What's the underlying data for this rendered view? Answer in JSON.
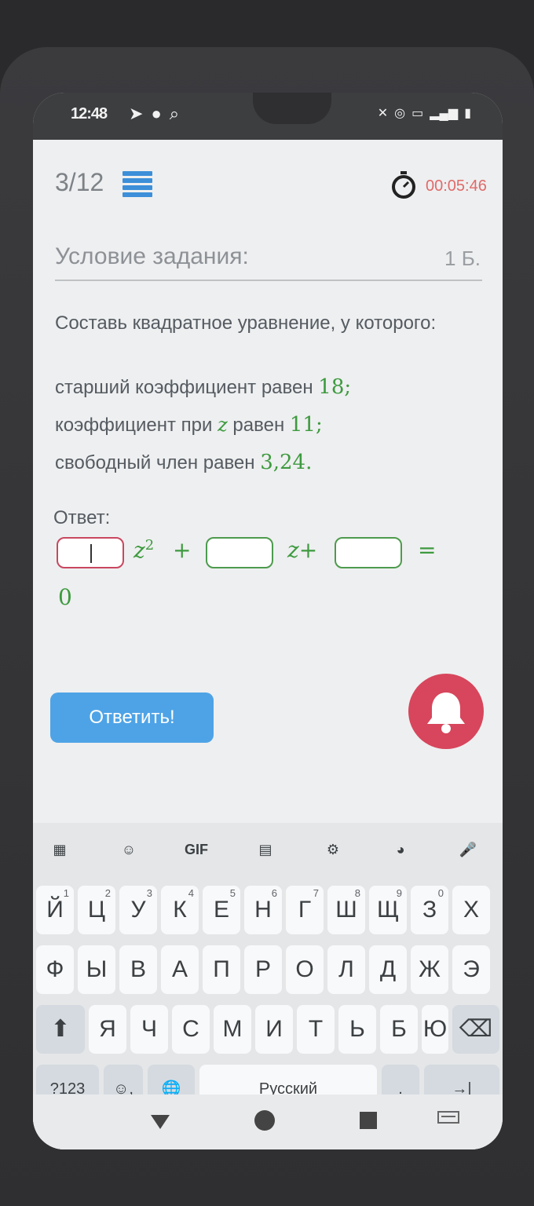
{
  "status_bar": {
    "time": "12:48",
    "left_icons": [
      "telegram-icon",
      "circle-icon",
      "search-icon"
    ],
    "right_icons": [
      "mute-icon",
      "hotspot-icon",
      "network-icon",
      "signal-icon",
      "battery-icon"
    ]
  },
  "header": {
    "counter": "3/12",
    "timer": "00:05:46"
  },
  "task": {
    "section_title": "Условие задания:",
    "score": "1 Б.",
    "prompt": "Составь квадратное уравнение, у которого:",
    "conditions": [
      {
        "text": "старший коэффициент равен ",
        "value": "18",
        "suffix": ";"
      },
      {
        "text": "коэффициент при ",
        "var": "z",
        "text2": " равен ",
        "value": "11",
        "suffix": ";"
      },
      {
        "text": "свободный член равен ",
        "value": "3,24",
        "suffix": "."
      }
    ]
  },
  "answer": {
    "label": "Ответ:",
    "term1": "z",
    "exp": "2",
    "plus": "+",
    "term2": "z+",
    "equals": "=",
    "rhs": "0"
  },
  "buttons": {
    "submit": "Ответить!"
  },
  "keyboard": {
    "toolbar": [
      "apps-icon",
      "sticker-icon",
      "GIF",
      "clipboard-icon",
      "gear-icon",
      "palette-icon",
      "mic-icon"
    ],
    "row1": [
      [
        "Й",
        "1"
      ],
      [
        "Ц",
        "2"
      ],
      [
        "У",
        "3"
      ],
      [
        "К",
        "4"
      ],
      [
        "Е",
        "5"
      ],
      [
        "Н",
        "6"
      ],
      [
        "Г",
        "7"
      ],
      [
        "Ш",
        "8"
      ],
      [
        "Щ",
        "9"
      ],
      [
        "З",
        "0"
      ],
      [
        "Х",
        ""
      ]
    ],
    "row2": [
      "Ф",
      "Ы",
      "В",
      "А",
      "П",
      "Р",
      "О",
      "Л",
      "Д",
      "Ж",
      "Э"
    ],
    "row3": [
      "Я",
      "Ч",
      "С",
      "М",
      "И",
      "Т",
      "Ь",
      "Б",
      "Ю"
    ],
    "symbols": "?123",
    "emoji_comma": ",",
    "space": "Русский",
    "period": ".",
    "enter": "→|"
  },
  "colors": {
    "accent": "#4ea3e6",
    "math_green": "#3d9a3f",
    "bell": "#d7465c",
    "timer": "#e06a6a"
  }
}
